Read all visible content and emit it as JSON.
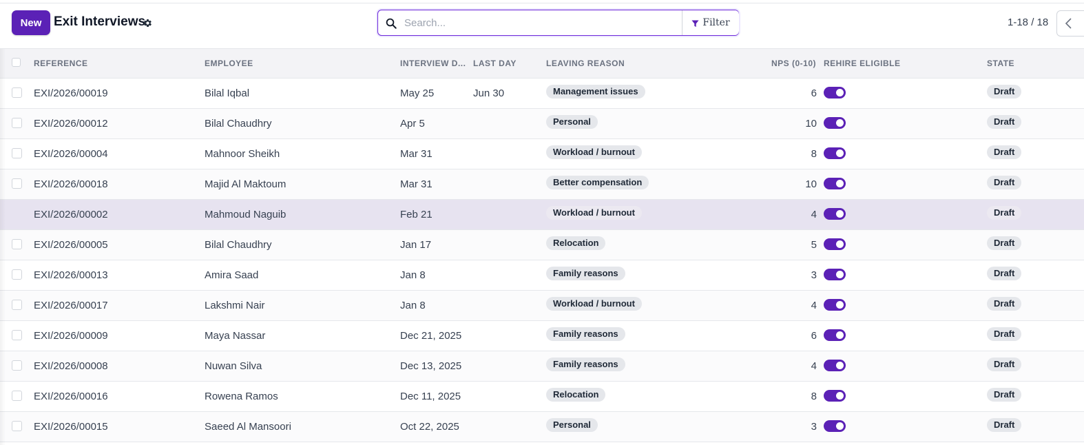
{
  "control_panel": {
    "new_label": "New",
    "title": "Exit Interviews",
    "search_placeholder": "Search...",
    "filter_label": "Filter",
    "pager": "1-18 / 18"
  },
  "columns": {
    "reference": "Reference",
    "employee": "Employee",
    "interview_date": "Interview D...",
    "last_day": "Last Day",
    "leaving_reason": "Leaving Reason",
    "nps": "NPS (0-10)",
    "rehire": "Rehire Eligible",
    "state": "State"
  },
  "rows": [
    {
      "ref": "EXI/2026/00019",
      "employee": "Bilal Iqbal",
      "date": "May 25",
      "last_day": "Jun 30",
      "reason": "Management issues",
      "nps": "6",
      "rehire": true,
      "state": "Draft"
    },
    {
      "ref": "EXI/2026/00012",
      "employee": "Bilal Chaudhry",
      "date": "Apr 5",
      "last_day": "",
      "reason": "Personal",
      "nps": "10",
      "rehire": true,
      "state": "Draft"
    },
    {
      "ref": "EXI/2026/00004",
      "employee": "Mahnoor Sheikh",
      "date": "Mar 31",
      "last_day": "",
      "reason": "Workload / burnout",
      "nps": "8",
      "rehire": true,
      "state": "Draft"
    },
    {
      "ref": "EXI/2026/00018",
      "employee": "Majid Al Maktoum",
      "date": "Mar 31",
      "last_day": "",
      "reason": "Better compensation",
      "nps": "10",
      "rehire": true,
      "state": "Draft"
    },
    {
      "ref": "EXI/2026/00002",
      "employee": "Mahmoud Naguib",
      "date": "Feb 21",
      "last_day": "",
      "reason": "Workload / burnout",
      "nps": "4",
      "rehire": true,
      "state": "Draft"
    },
    {
      "ref": "EXI/2026/00005",
      "employee": "Bilal Chaudhry",
      "date": "Jan 17",
      "last_day": "",
      "reason": "Relocation",
      "nps": "5",
      "rehire": true,
      "state": "Draft"
    },
    {
      "ref": "EXI/2026/00013",
      "employee": "Amira Saad",
      "date": "Jan 8",
      "last_day": "",
      "reason": "Family reasons",
      "nps": "3",
      "rehire": true,
      "state": "Draft"
    },
    {
      "ref": "EXI/2026/00017",
      "employee": "Lakshmi Nair",
      "date": "Jan 8",
      "last_day": "",
      "reason": "Workload / burnout",
      "nps": "4",
      "rehire": true,
      "state": "Draft"
    },
    {
      "ref": "EXI/2026/00009",
      "employee": "Maya Nassar",
      "date": "Dec 21, 2025",
      "last_day": "",
      "reason": "Family reasons",
      "nps": "6",
      "rehire": true,
      "state": "Draft"
    },
    {
      "ref": "EXI/2026/00008",
      "employee": "Nuwan Silva",
      "date": "Dec 13, 2025",
      "last_day": "",
      "reason": "Family reasons",
      "nps": "4",
      "rehire": true,
      "state": "Draft"
    },
    {
      "ref": "EXI/2026/00016",
      "employee": "Rowena Ramos",
      "date": "Dec 11, 2025",
      "last_day": "",
      "reason": "Relocation",
      "nps": "8",
      "rehire": true,
      "state": "Draft"
    },
    {
      "ref": "EXI/2026/00015",
      "employee": "Saeed Al Mansoori",
      "date": "Oct 22, 2025",
      "last_day": "",
      "reason": "Personal",
      "nps": "3",
      "rehire": true,
      "state": "Draft"
    }
  ],
  "colors": {
    "accent": "#5b21b6",
    "selected_row": "#e7e3f0",
    "tag_bg": "#e5e7eb"
  },
  "icons": [
    "gear-icon",
    "search-icon",
    "filter-icon",
    "chevron-left-icon"
  ]
}
